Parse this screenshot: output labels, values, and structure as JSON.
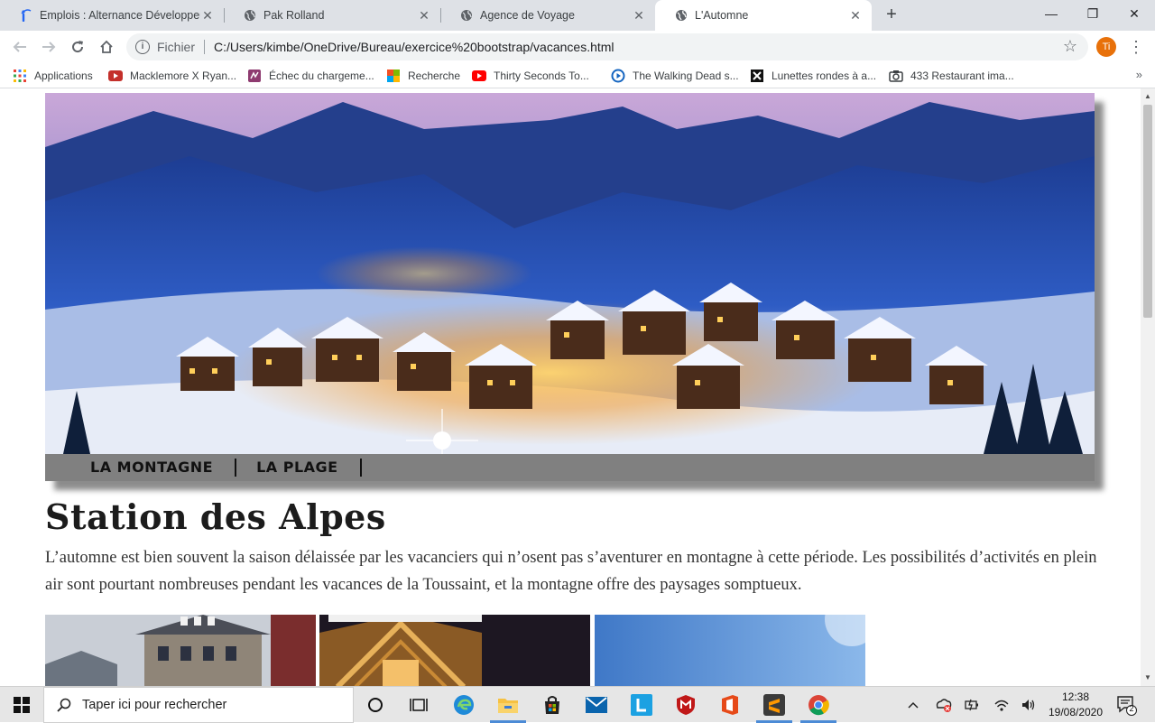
{
  "browser": {
    "tabs": [
      {
        "title": "Emplois : Alternance Développeu",
        "favicon": "indeed-icon",
        "active": false
      },
      {
        "title": "Pak Rolland",
        "favicon": "globe-icon",
        "active": false
      },
      {
        "title": "Agence de Voyage",
        "favicon": "globe-icon",
        "active": false
      },
      {
        "title": "L'Automne",
        "favicon": "globe-icon",
        "active": true
      }
    ],
    "scheme_label": "Fichier",
    "url": "C:/Users/kimbe/OneDrive/Bureau/exercice%20bootstrap/vacances.html",
    "profile_initials": "Ti",
    "profile_color": "#e8710a",
    "bookmarks": [
      {
        "label": "Applications",
        "icon": "apps-grid-icon"
      },
      {
        "label": "Macklemore X Ryan...",
        "icon": "youtube-icon"
      },
      {
        "label": "Échec du chargeme...",
        "icon": "page-icon"
      },
      {
        "label": "Recherche",
        "icon": "colorful-squares-icon"
      },
      {
        "label": "Thirty Seconds To...",
        "icon": "youtube-icon"
      },
      {
        "label": "The Walking Dead s...",
        "icon": "play-circle-icon"
      },
      {
        "label": "Lunettes rondes à a...",
        "icon": "x-box-icon"
      },
      {
        "label": "433 Restaurant ima...",
        "icon": "camera-icon"
      }
    ]
  },
  "page": {
    "nav": [
      "LA MONTAGNE",
      "LA PLAGE"
    ],
    "title": "Station des Alpes",
    "intro": "L’automne est bien souvent la saison délaissée par les vacanciers qui n’osent pas s’aventurer en montagne à cette période. Les possibilités d’activités en plein air sont pourtant nombreuses pendant les vacances de la Toussaint, et la montagne offre des paysages somptueux."
  },
  "taskbar": {
    "search_placeholder": "Taper ici pour rechercher",
    "time": "12:38",
    "date": "19/08/2020",
    "notification_count": "2"
  }
}
